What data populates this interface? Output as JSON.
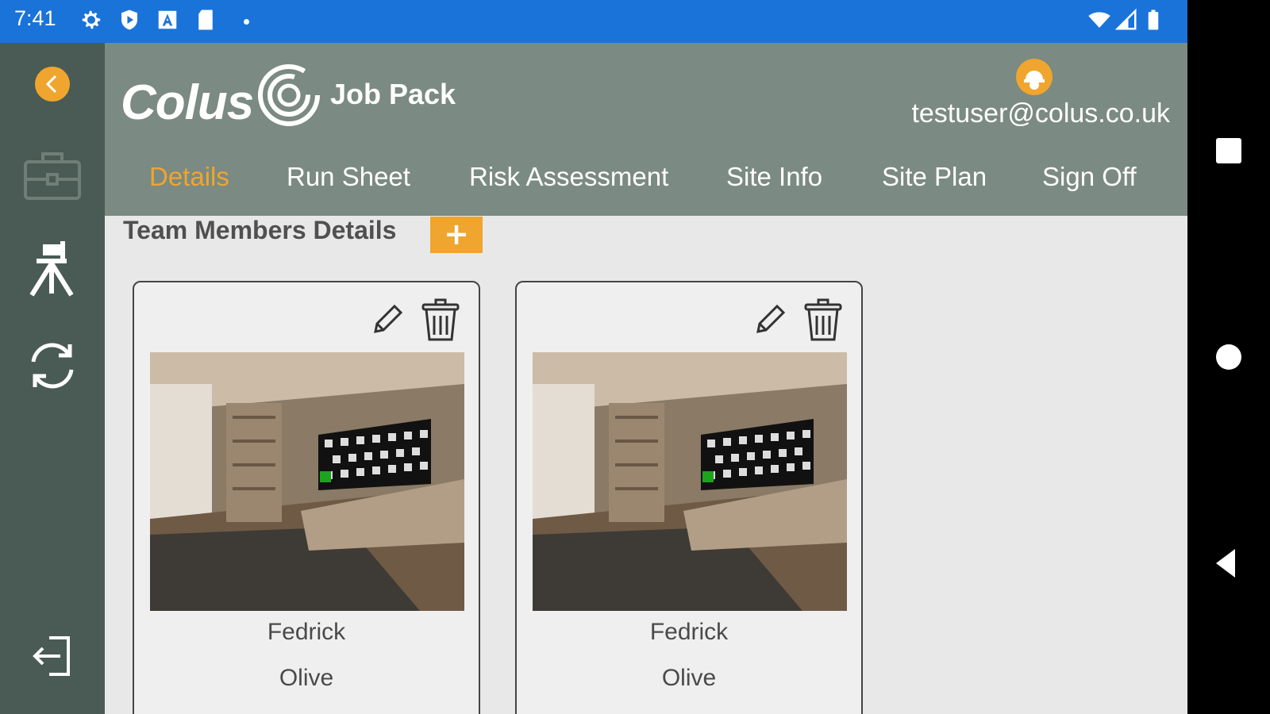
{
  "status_bar": {
    "time": "7:41",
    "icons": [
      "gear-icon",
      "shield-icon",
      "font-icon",
      "sd-card-icon",
      "dot-icon",
      "wifi-icon",
      "signal-icon",
      "battery-icon"
    ]
  },
  "header": {
    "logo_text": "Colus",
    "app_name": "Job Pack",
    "user_email": "testuser@colus.co.uk"
  },
  "tabs": [
    {
      "label": "Details",
      "active": true
    },
    {
      "label": "Run Sheet",
      "active": false
    },
    {
      "label": "Risk Assessment",
      "active": false
    },
    {
      "label": "Site Info",
      "active": false
    },
    {
      "label": "Site Plan",
      "active": false
    },
    {
      "label": "Sign Off",
      "active": false
    }
  ],
  "sidebar": {
    "items": [
      "back-icon",
      "briefcase-icon",
      "survey-tripod-icon",
      "sync-icon",
      "logout-icon"
    ]
  },
  "section": {
    "title": "Team Members Details",
    "add_label": "+"
  },
  "team_members": [
    {
      "first_name": "Fedrick",
      "last_name": "Olive"
    },
    {
      "first_name": "Fedrick",
      "last_name": "Olive"
    }
  ],
  "colors": {
    "accent": "#f0a52e",
    "header_bg": "#7b8a82",
    "sidebar_bg": "#4a5b55",
    "status_bar": "#1a73d9"
  }
}
